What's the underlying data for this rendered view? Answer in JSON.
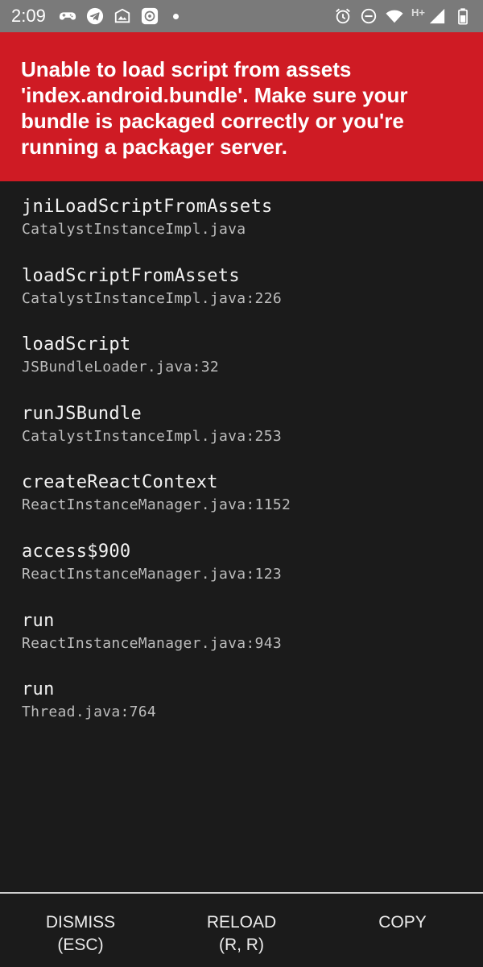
{
  "status_bar": {
    "time": "2:09",
    "network_type": "H+",
    "left_icons": [
      "gamepad-icon",
      "telegram-icon",
      "photo-share-icon",
      "camera-app-icon"
    ],
    "right_icons": [
      "alarm-icon",
      "do-not-disturb-icon",
      "wifi-icon",
      "cell-signal-icon",
      "battery-icon"
    ]
  },
  "error": {
    "message": "Unable to load script from assets\n'index.android.bundle'. Make sure your\nbundle is packaged correctly or you're\nrunning a packager server.",
    "color": "#cf1b24"
  },
  "stack": [
    {
      "method": "jniLoadScriptFromAssets",
      "file": "CatalystInstanceImpl.java"
    },
    {
      "method": "loadScriptFromAssets",
      "file": "CatalystInstanceImpl.java:226"
    },
    {
      "method": "loadScript",
      "file": "JSBundleLoader.java:32"
    },
    {
      "method": "runJSBundle",
      "file": "CatalystInstanceImpl.java:253"
    },
    {
      "method": "createReactContext",
      "file": "ReactInstanceManager.java:1152"
    },
    {
      "method": "access$900",
      "file": "ReactInstanceManager.java:123"
    },
    {
      "method": "run",
      "file": "ReactInstanceManager.java:943"
    },
    {
      "method": "run",
      "file": "Thread.java:764"
    }
  ],
  "buttons": {
    "dismiss": "DISMISS\n(ESC)",
    "reload": "RELOAD\n(R, R)",
    "copy": "COPY"
  }
}
